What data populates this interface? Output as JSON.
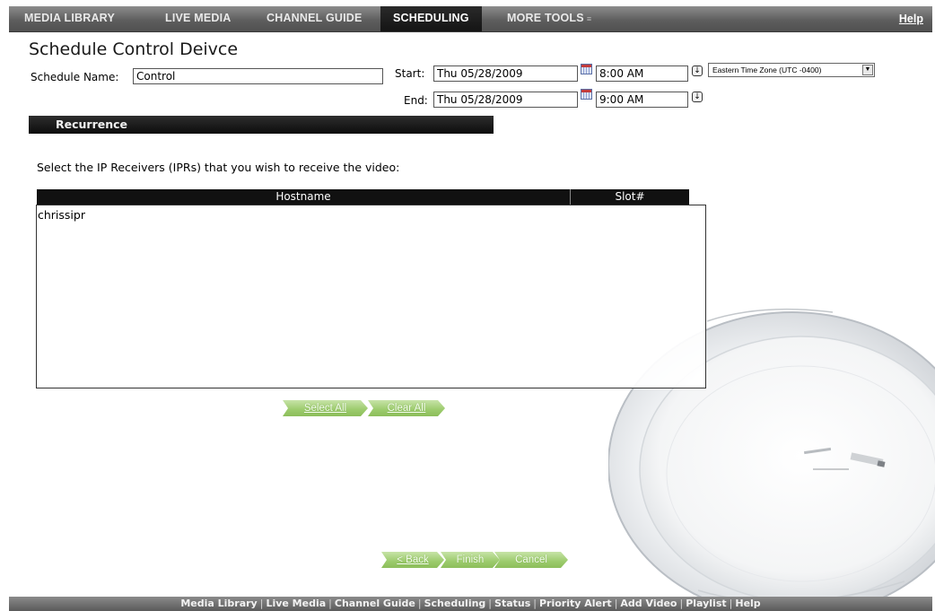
{
  "nav": {
    "items": [
      {
        "label": "MEDIA LIBRARY"
      },
      {
        "label": "LIVE MEDIA"
      },
      {
        "label": "CHANNEL GUIDE"
      },
      {
        "label": "SCHEDULING"
      },
      {
        "label": "MORE TOOLS"
      }
    ],
    "active": "SCHEDULING",
    "help": "Help"
  },
  "page": {
    "title": "Schedule Control Deivce"
  },
  "form": {
    "schedule_name_label": "Schedule Name:",
    "schedule_name_value": "Control",
    "start_label": "Start:",
    "start_date": "Thu 05/28/2009",
    "start_time": "8:00 AM",
    "end_label": "End:",
    "end_date": "Thu 05/28/2009",
    "end_time": "9:00 AM",
    "timezone": "Eastern Time Zone (UTC -0400)"
  },
  "recurrence": {
    "label": "Recurrence"
  },
  "receivers": {
    "instruction": "Select the IP Receivers (IPRs) that you wish to receive the video:",
    "columns": [
      "Hostname",
      "Slot#"
    ],
    "rows": [
      {
        "hostname": "chrissipr",
        "slot": ""
      }
    ]
  },
  "buttons": {
    "select_all": "Select All",
    "clear_all": "Clear All",
    "back": "< Back",
    "finish": "Finish",
    "cancel": "Cancel"
  },
  "footer": {
    "links": [
      "Media Library",
      "Live Media",
      "Channel Guide",
      "Scheduling",
      "Status",
      "Priority Alert",
      "Add Video",
      "Playlist",
      "Help"
    ]
  },
  "colors": {
    "nav_bg": "#5e5e5e",
    "nav_active": "#141414",
    "button_green": "#9ccb6c",
    "footer_bg": "#6a6a6a"
  },
  "icons": [
    "calendar-icon",
    "down-arrow-icon",
    "dropdown-arrow-icon",
    "chevron-down-icon"
  ]
}
